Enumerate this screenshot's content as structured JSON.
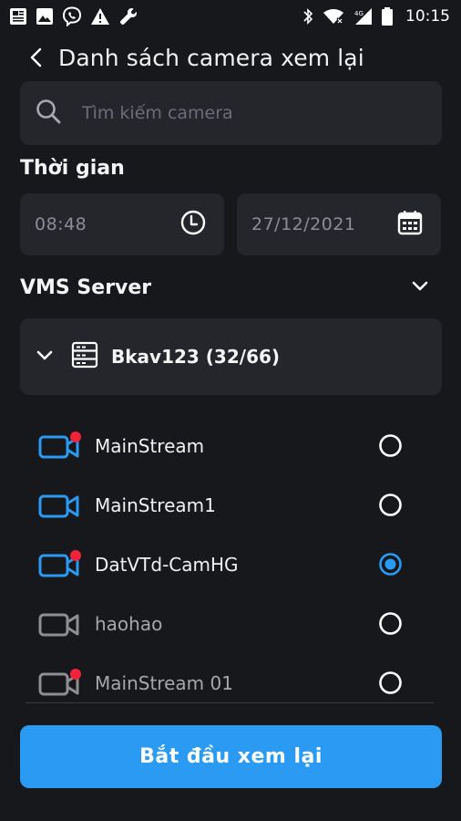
{
  "status_bar": {
    "time": "10:15",
    "left_icons": [
      "news-icon",
      "image-icon",
      "viber-icon",
      "warning-icon",
      "wrench-icon"
    ],
    "right_icons": [
      "bluetooth-icon",
      "wifi-icon",
      "signal-4g-icon",
      "battery-icon"
    ],
    "network_label": "4G"
  },
  "header": {
    "title": "Danh sách camera xem lại"
  },
  "search": {
    "placeholder": "Tìm kiếm camera"
  },
  "time_section": {
    "label": "Thời gian",
    "time_value": "08:48",
    "date_value": "27/12/2021"
  },
  "vms": {
    "label": "VMS Server",
    "server_name": "Bkav123 (32/66)"
  },
  "cameras": [
    {
      "name": "MainStream",
      "online": true,
      "alert": true,
      "selected": false
    },
    {
      "name": "MainStream1",
      "online": true,
      "alert": false,
      "selected": false
    },
    {
      "name": "DatVTd-CamHG",
      "online": true,
      "alert": true,
      "selected": true
    },
    {
      "name": "haohao",
      "online": false,
      "alert": false,
      "selected": false
    },
    {
      "name": "MainStream 01",
      "online": false,
      "alert": true,
      "selected": false
    }
  ],
  "start_button": {
    "label": "Bắt đầu xem lại"
  },
  "colors": {
    "background": "#17181c",
    "card": "#25262b",
    "accent": "#2a9af3",
    "camera_online": "#2a9af3",
    "camera_offline": "#8e8f93",
    "alert_dot": "#f2233b"
  }
}
